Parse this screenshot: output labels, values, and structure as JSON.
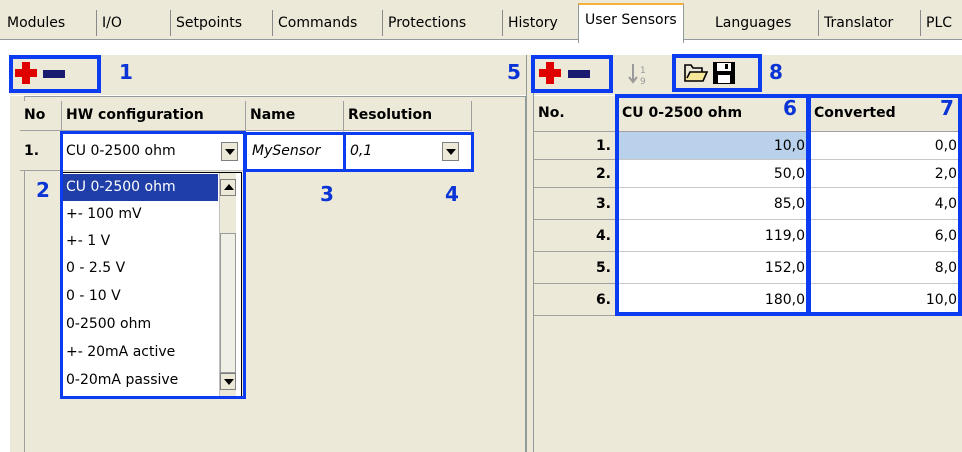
{
  "tabs": [
    "Modules",
    "I/O",
    "Setpoints",
    "Commands",
    "Protections",
    "History",
    "User Sensors",
    "Languages",
    "Translator",
    "PLC"
  ],
  "active_tab": "User Sensors",
  "annotations": [
    "1",
    "2",
    "3",
    "4",
    "5",
    "6",
    "7",
    "8"
  ],
  "left_grid": {
    "headers": [
      "No",
      "HW configuration",
      "Name",
      "Resolution"
    ],
    "row": {
      "no": "1.",
      "hw": "CU 0-2500 ohm",
      "name": "MySensor",
      "resolution": "0,1"
    },
    "hw_options": [
      "CU 0-2500 ohm",
      "+- 100 mV",
      "+- 1 V",
      "0 - 2.5 V",
      "0 - 10 V",
      "0-2500 ohm",
      "+- 20mA active",
      "0-20mA passive"
    ],
    "selected_option": "CU 0-2500 ohm"
  },
  "right_toolbar": {
    "sort_icon": "sort-descending-icon",
    "open_icon": "folder-open-icon",
    "save_icon": "floppy-disk-icon"
  },
  "right_grid": {
    "headers": [
      "No.",
      "CU 0-2500 ohm",
      "Converted"
    ],
    "rows": [
      {
        "no": "1.",
        "value": "10,0",
        "converted": "0,0"
      },
      {
        "no": "2.",
        "value": "50,0",
        "converted": "2,0"
      },
      {
        "no": "3.",
        "value": "85,0",
        "converted": "4,0"
      },
      {
        "no": "4.",
        "value": "119,0",
        "converted": "6,0"
      },
      {
        "no": "5.",
        "value": "152,0",
        "converted": "8,0"
      },
      {
        "no": "6.",
        "value": "180,0",
        "converted": "10,0"
      }
    ]
  },
  "colors": {
    "annotation": "#0c3cf0",
    "selected_row": "#1f3ea8",
    "active_cell": "#b9d1ea",
    "add_icon": "#e00000"
  }
}
